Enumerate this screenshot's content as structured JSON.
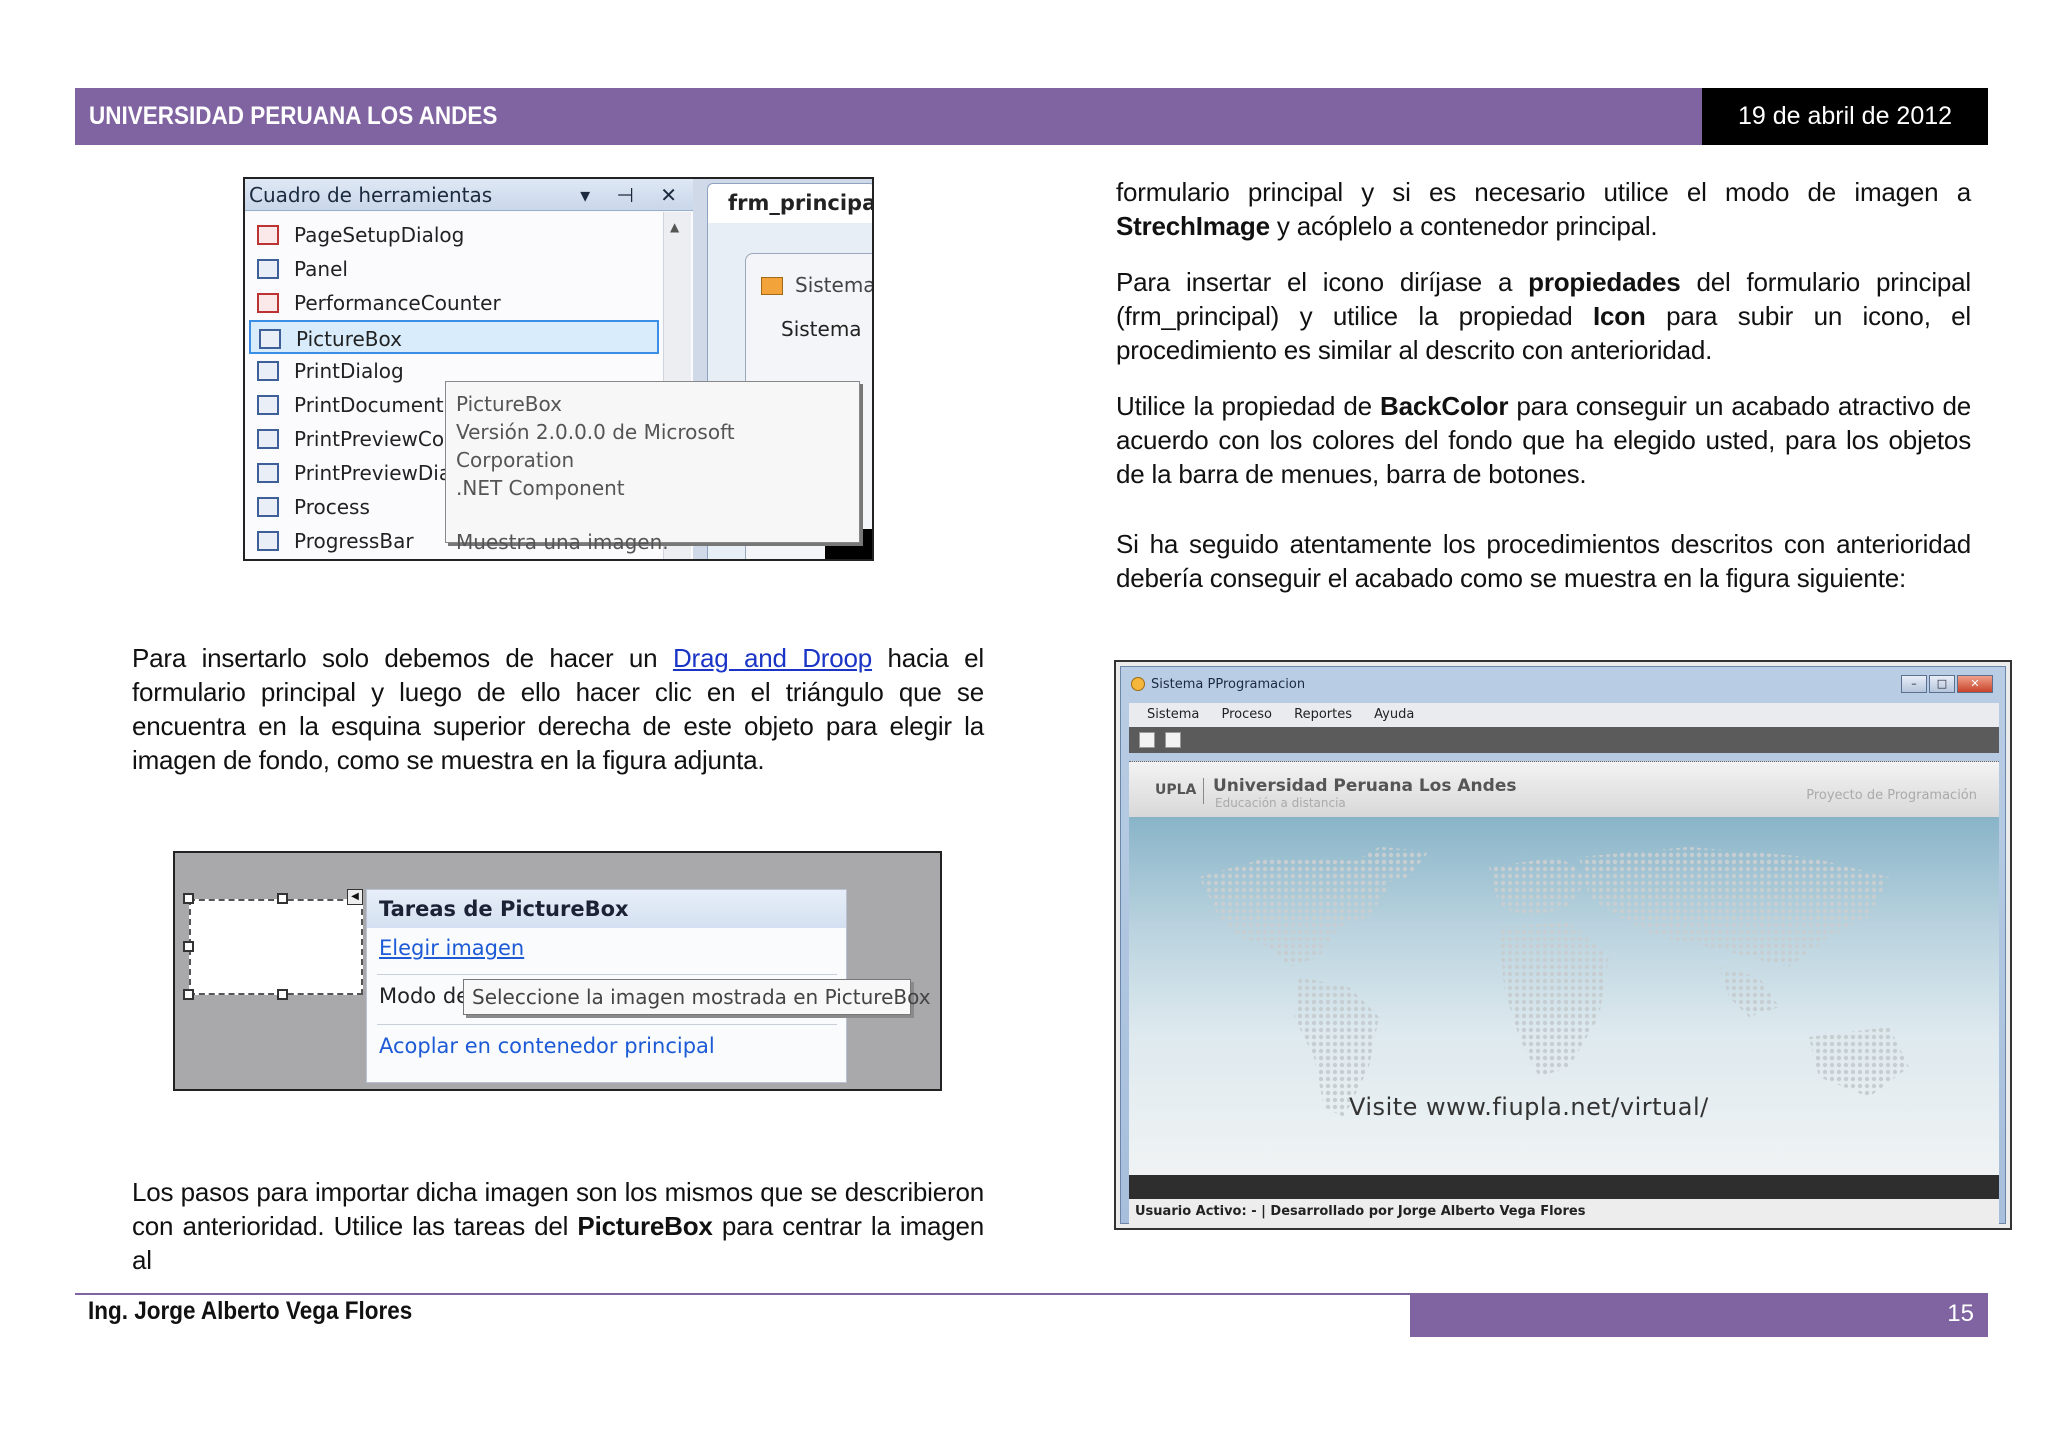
{
  "header": {
    "title": "UNIVERSIDAD PERUANA LOS ANDES",
    "date": "19 de abril de 2012"
  },
  "footer": {
    "author": "Ing. Jorge Alberto Vega Flores",
    "page": "15"
  },
  "toolbox": {
    "title": "Cuadro de herramientas",
    "controls": "▾ ⊣ ✕",
    "items": [
      "PageSetupDialog",
      "Panel",
      "PerformanceCounter",
      "PictureBox",
      "PrintDialog",
      "PrintDocument",
      "PrintPreviewCo",
      "PrintPreviewDia",
      "Process",
      "ProgressBar"
    ],
    "selected": "PictureBox",
    "tab": "frm_principal.",
    "sistema_tab": "Sistema",
    "sistema_menu": "Sistema",
    "tooltip": {
      "line1": "PictureBox",
      "line2": "Versión 2.0.0.0 de Microsoft Corporation",
      "line3": ".NET Component",
      "line4": "Muestra una imagen."
    }
  },
  "tasks": {
    "title": "Tareas de PictureBox",
    "choose_image": "Elegir imagen",
    "mode_label": "Modo de",
    "dock": "Acoplar en contenedor principal",
    "tooltip": "Seleccione la imagen mostrada en PictureBox"
  },
  "app": {
    "window_title": "Sistema PProgramacion",
    "menu": [
      "Sistema",
      "Proceso",
      "Reportes",
      "Ayuda"
    ],
    "upla": "UPLA",
    "university": "Universidad Peruana Los Andes",
    "subtitle": "Educación a distancia",
    "project": "Proyecto de Programación",
    "visit": "Visite www.fiupla.net/virtual/",
    "status": "Usuario Activo:  -  |  Desarrollado por Jorge Alberto Vega Flores"
  },
  "text": {
    "p1_a": "Para insertarlo solo debemos de hacer un ",
    "p1_link": "Drag and Droop",
    "p1_b": " hacia el formulario principal y luego de ello hacer clic en el triángulo que se encuentra en la esquina superior derecha de este objeto para elegir la imagen de fondo, como se muestra en la figura adjunta.",
    "p2_a": "Los pasos para importar dicha imagen son los mismos que se describieron con anterioridad. Utilice las tareas del ",
    "p2_b": "PictureBox",
    "p2_c": " para centrar la imagen al",
    "r1_a": "formulario principal y si es necesario utilice el modo de imagen a ",
    "r1_b": "StrechImage",
    "r1_c": " y acóplelo a contenedor principal.",
    "r2_a": "Para insertar el icono diríjase a ",
    "r2_b": "propiedades",
    "r2_c": " del formulario principal (frm_principal) y utilice la propiedad ",
    "r2_d": "Icon",
    "r2_e": " para subir un icono, el procedimiento es similar al descrito con anterioridad.",
    "r3_a": "Utilice la propiedad de ",
    "r3_b": "BackColor",
    "r3_c": " para conseguir un acabado atractivo de acuerdo con los colores del fondo que ha elegido usted, para los objetos de la barra de menues, barra de botones.",
    "r4": "Si ha seguido atentamente los procedimientos descritos con anterioridad debería conseguir el acabado como se muestra en la figura siguiente:"
  }
}
